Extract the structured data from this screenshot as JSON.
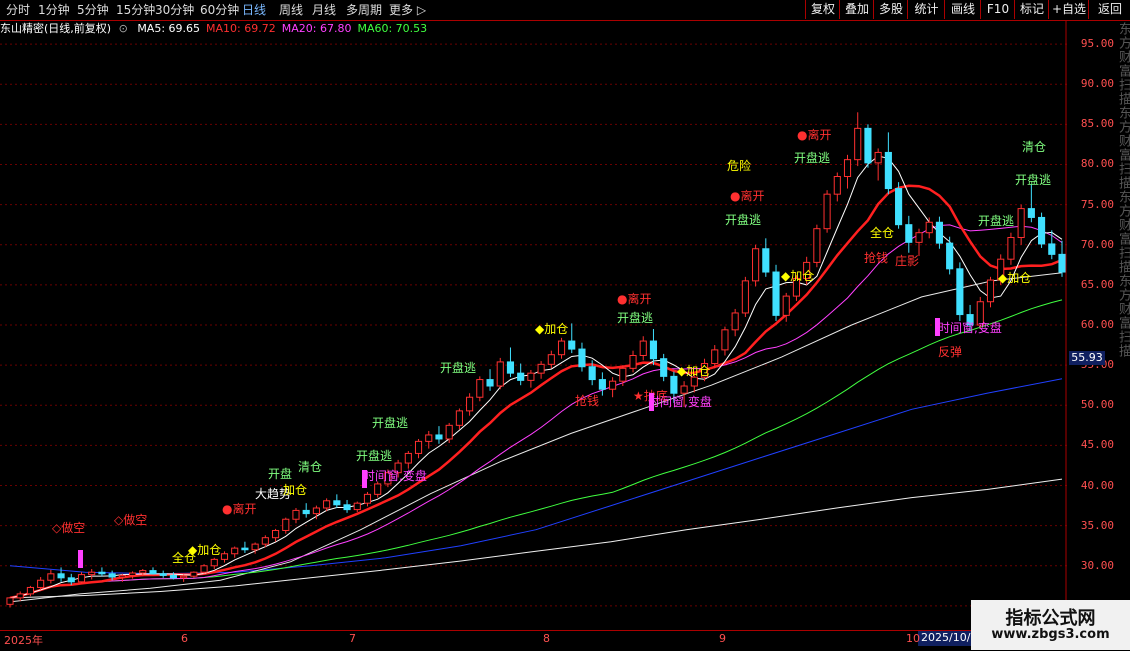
{
  "toolbar": {
    "left_tabs": [
      "分时",
      "1分钟",
      "5分钟",
      "15分钟",
      "30分钟",
      "60分钟",
      "日线",
      "周线",
      "月线",
      "多周期",
      "更多 ▷"
    ],
    "active": "日线",
    "right_buttons": [
      "复权",
      "叠加",
      "多股",
      "统计",
      "画线",
      "F10",
      "标记",
      "+自选",
      "返回"
    ]
  },
  "stock": {
    "title": "东山精密(日线,前复权)",
    "circle_btn": "⊙"
  },
  "ma": [
    {
      "label": "MA5: 69.65",
      "color": "#ffffff"
    },
    {
      "label": "MA10: 69.72",
      "color": "#ff3030"
    },
    {
      "label": "MA20: 67.80",
      "color": "#ff40ff"
    },
    {
      "label": "MA60: 70.53",
      "color": "#40ff40"
    }
  ],
  "price_axis": [
    "95.00",
    "90.00",
    "85.00",
    "80.00",
    "75.00",
    "70.00",
    "65.00",
    "60.00",
    "55.00",
    "50.00",
    "45.00",
    "40.00",
    "35.00",
    "30.00",
    "25.00"
  ],
  "current_price": "55.93",
  "date_axis": {
    "labels": [
      "2025年",
      "6",
      "7",
      "8",
      "9",
      "10"
    ],
    "hover_date": "2025/10/1"
  },
  "side_text": "东方财富扫描东方财富扫描东方财富扫描东方财富扫描",
  "signals": [
    {
      "text": "◇做空",
      "color": "#ff3030"
    },
    {
      "text": "◇做空",
      "color": "#ff3030"
    },
    {
      "text": "◆加仓",
      "color": "#ffff00"
    },
    {
      "text": "全仓",
      "color": "#ffff00"
    },
    {
      "text": "●离开",
      "color": "#ff3030"
    },
    {
      "text": "大趋势",
      "color": "#ffffff"
    },
    {
      "text": "加仓",
      "color": "#ffff00"
    },
    {
      "text": "清仓",
      "color": "#80ff80"
    },
    {
      "text": "开盘",
      "color": "#80ff80"
    },
    {
      "text": "时间窗,变盘",
      "color": "#ff40ff"
    },
    {
      "text": "开盘逃",
      "color": "#80ff80"
    },
    {
      "text": "开盘逃",
      "color": "#80ff80"
    },
    {
      "text": "开盘逃",
      "color": "#80ff80"
    },
    {
      "text": "◆加仓",
      "color": "#ffff00"
    },
    {
      "text": "●离开",
      "color": "#ff3030"
    },
    {
      "text": "开盘逃",
      "color": "#80ff80"
    },
    {
      "text": "抢钱",
      "color": "#ff3030"
    },
    {
      "text": "★抄底",
      "color": "#ff3030"
    },
    {
      "text": "时间窗,变盘",
      "color": "#ff40ff"
    },
    {
      "text": "◆加仓",
      "color": "#ffff00"
    },
    {
      "text": "危险",
      "color": "#ffff00"
    },
    {
      "text": "●离开",
      "color": "#ff3030"
    },
    {
      "text": "开盘逃",
      "color": "#80ff80"
    },
    {
      "text": "◆加仓",
      "color": "#ffff00"
    },
    {
      "text": "●离开",
      "color": "#ff3030"
    },
    {
      "text": "开盘逃",
      "color": "#80ff80"
    },
    {
      "text": "全仓",
      "color": "#ffff00"
    },
    {
      "text": "抢钱",
      "color": "#ff3030"
    },
    {
      "text": "庄影",
      "color": "#ff3030"
    },
    {
      "text": "时间窗,变盘",
      "color": "#ff40ff"
    },
    {
      "text": "反弹",
      "color": "#ff3030"
    },
    {
      "text": "开盘逃",
      "color": "#80ff80"
    },
    {
      "text": "◆加仓",
      "color": "#ffff00"
    },
    {
      "text": "清仓",
      "color": "#80ff80"
    },
    {
      "text": "开盘逃",
      "color": "#80ff80"
    }
  ],
  "watermark": {
    "line1": "指标公式网",
    "line2": "www.zbgs3.com"
  },
  "chart_data": {
    "type": "candlestick",
    "ylim": [
      22,
      98
    ],
    "y_ticks": [
      95,
      90,
      85,
      80,
      75,
      70,
      65,
      60,
      55,
      50,
      45,
      40,
      35,
      30,
      25
    ],
    "candles": [
      [
        25.2,
        26.1,
        24.8,
        26.0
      ],
      [
        26.0,
        26.8,
        25.6,
        26.5
      ],
      [
        26.5,
        27.5,
        26.2,
        27.3
      ],
      [
        27.3,
        28.6,
        27.0,
        28.2
      ],
      [
        28.2,
        29.5,
        27.8,
        29.0
      ],
      [
        29.0,
        29.8,
        28.0,
        28.5
      ],
      [
        28.5,
        29.0,
        27.6,
        28.0
      ],
      [
        28.0,
        29.2,
        27.8,
        28.9
      ],
      [
        28.9,
        29.6,
        28.3,
        29.2
      ],
      [
        29.2,
        29.8,
        28.7,
        29.0
      ],
      [
        29.0,
        29.4,
        28.2,
        28.6
      ],
      [
        28.6,
        29.0,
        28.0,
        28.8
      ],
      [
        28.8,
        29.3,
        28.4,
        29.1
      ],
      [
        29.1,
        29.6,
        28.7,
        29.4
      ],
      [
        29.4,
        29.8,
        28.9,
        29.0
      ],
      [
        29.0,
        29.4,
        28.5,
        28.8
      ],
      [
        28.8,
        29.2,
        28.3,
        28.5
      ],
      [
        28.5,
        28.9,
        28.0,
        28.7
      ],
      [
        28.7,
        29.3,
        28.5,
        29.2
      ],
      [
        29.2,
        30.2,
        29.0,
        30.0
      ],
      [
        30.0,
        31.0,
        29.6,
        30.8
      ],
      [
        30.8,
        31.8,
        30.4,
        31.5
      ],
      [
        31.5,
        32.4,
        31.0,
        32.2
      ],
      [
        32.2,
        33.0,
        31.6,
        32.0
      ],
      [
        32.0,
        32.9,
        31.5,
        32.7
      ],
      [
        32.7,
        33.8,
        32.3,
        33.5
      ],
      [
        33.5,
        34.6,
        33.0,
        34.4
      ],
      [
        34.4,
        36.0,
        34.0,
        35.8
      ],
      [
        35.8,
        37.2,
        35.3,
        36.9
      ],
      [
        36.9,
        37.8,
        36.0,
        36.5
      ],
      [
        36.5,
        37.5,
        35.8,
        37.2
      ],
      [
        37.2,
        38.4,
        36.8,
        38.1
      ],
      [
        38.1,
        38.9,
        37.2,
        37.6
      ],
      [
        37.6,
        38.2,
        36.6,
        37.0
      ],
      [
        37.0,
        38.0,
        36.7,
        37.8
      ],
      [
        37.8,
        39.2,
        37.4,
        38.9
      ],
      [
        38.9,
        40.5,
        38.5,
        40.2
      ],
      [
        40.2,
        42.0,
        39.8,
        41.6
      ],
      [
        41.6,
        43.2,
        41.0,
        42.8
      ],
      [
        42.8,
        44.3,
        42.1,
        44.0
      ],
      [
        44.0,
        45.8,
        43.4,
        45.5
      ],
      [
        45.5,
        46.8,
        44.6,
        46.3
      ],
      [
        46.3,
        47.4,
        45.2,
        45.8
      ],
      [
        45.8,
        47.8,
        45.3,
        47.5
      ],
      [
        47.5,
        49.6,
        47.0,
        49.3
      ],
      [
        49.3,
        51.5,
        48.7,
        51.0
      ],
      [
        51.0,
        53.6,
        50.5,
        53.2
      ],
      [
        53.2,
        54.5,
        51.8,
        52.4
      ],
      [
        52.4,
        55.9,
        52.0,
        55.4
      ],
      [
        55.4,
        57.2,
        53.5,
        54.0
      ],
      [
        54.0,
        55.2,
        52.5,
        53.1
      ],
      [
        53.1,
        54.4,
        52.2,
        54.0
      ],
      [
        54.0,
        55.5,
        53.3,
        55.1
      ],
      [
        55.1,
        56.8,
        54.6,
        56.3
      ],
      [
        56.3,
        58.4,
        55.8,
        58.0
      ],
      [
        58.0,
        60.2,
        56.5,
        57.0
      ],
      [
        57.0,
        57.8,
        54.2,
        54.8
      ],
      [
        54.8,
        55.6,
        52.5,
        53.2
      ],
      [
        53.2,
        54.1,
        51.2,
        52.0
      ],
      [
        52.0,
        53.5,
        51.0,
        53.0
      ],
      [
        53.0,
        55.0,
        52.4,
        54.6
      ],
      [
        54.6,
        56.8,
        54.1,
        56.2
      ],
      [
        56.2,
        58.6,
        55.6,
        58.0
      ],
      [
        58.0,
        59.5,
        55.0,
        55.8
      ],
      [
        55.8,
        56.4,
        53.0,
        53.6
      ],
      [
        53.6,
        54.2,
        50.3,
        51.5
      ],
      [
        51.5,
        53.0,
        49.8,
        52.4
      ],
      [
        52.4,
        54.0,
        51.6,
        53.5
      ],
      [
        53.5,
        55.8,
        53.0,
        55.2
      ],
      [
        55.2,
        57.5,
        54.6,
        56.9
      ],
      [
        56.9,
        59.8,
        56.2,
        59.4
      ],
      [
        59.4,
        62.0,
        58.6,
        61.5
      ],
      [
        61.5,
        66.0,
        61.0,
        65.5
      ],
      [
        65.5,
        70.0,
        64.8,
        69.5
      ],
      [
        69.5,
        70.8,
        66.0,
        66.6
      ],
      [
        66.6,
        67.5,
        60.5,
        61.2
      ],
      [
        61.2,
        64.0,
        60.4,
        63.6
      ],
      [
        63.6,
        66.2,
        63.0,
        65.8
      ],
      [
        65.8,
        68.5,
        65.0,
        67.8
      ],
      [
        67.8,
        72.5,
        67.2,
        72.0
      ],
      [
        72.0,
        76.8,
        71.5,
        76.3
      ],
      [
        76.3,
        79.0,
        75.4,
        78.5
      ],
      [
        78.5,
        81.2,
        77.0,
        80.6
      ],
      [
        80.6,
        86.5,
        79.8,
        84.5
      ],
      [
        84.5,
        85.0,
        79.6,
        80.2
      ],
      [
        80.2,
        82.0,
        78.0,
        81.5
      ],
      [
        81.5,
        84.0,
        76.3,
        77.0
      ],
      [
        77.0,
        77.8,
        72.0,
        72.5
      ],
      [
        72.5,
        73.6,
        69.0,
        70.3
      ],
      [
        70.3,
        72.0,
        68.6,
        71.5
      ],
      [
        71.5,
        73.4,
        70.8,
        72.8
      ],
      [
        72.8,
        73.5,
        69.5,
        70.2
      ],
      [
        70.2,
        71.0,
        66.3,
        67.0
      ],
      [
        67.0,
        67.8,
        60.5,
        61.3
      ],
      [
        61.3,
        62.5,
        59.2,
        60.0
      ],
      [
        60.0,
        63.5,
        59.6,
        62.9
      ],
      [
        62.9,
        66.0,
        62.2,
        65.6
      ],
      [
        65.6,
        68.8,
        65.0,
        68.2
      ],
      [
        68.2,
        71.5,
        67.5,
        70.9
      ],
      [
        70.9,
        75.0,
        70.0,
        74.5
      ],
      [
        74.5,
        77.5,
        72.8,
        73.4
      ],
      [
        73.4,
        74.0,
        69.6,
        70.1
      ],
      [
        70.1,
        71.8,
        68.2,
        68.8
      ],
      [
        68.8,
        70.5,
        66.0,
        66.6
      ]
    ],
    "ma_series": [
      {
        "name": "MA5",
        "color": "#ffffff",
        "value": 69.65
      },
      {
        "name": "MA10",
        "color": "#ff3030",
        "value": 69.72
      },
      {
        "name": "MA20",
        "color": "#ff40ff",
        "value": 67.8
      },
      {
        "name": "MA60",
        "color": "#40ff40",
        "value": 70.53
      }
    ],
    "long_lines_color": [
      "#ffffff",
      "#2030ff",
      "#ffffff"
    ]
  }
}
